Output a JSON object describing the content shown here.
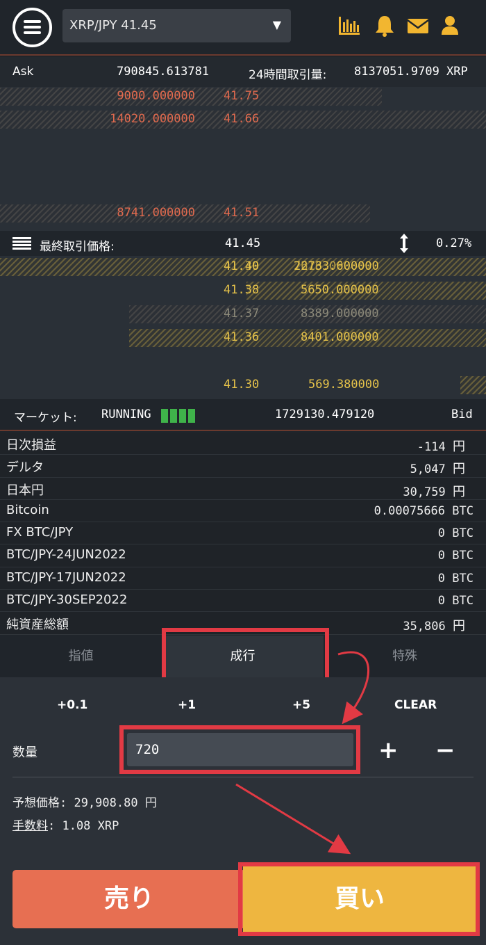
{
  "header": {
    "pair_selector": "XRP/JPY 41.45",
    "caret": "▼",
    "icons": [
      "chart-icon",
      "bell-icon",
      "mail-icon",
      "user-icon"
    ],
    "accent_color": "#f2b630"
  },
  "ask_bar": {
    "label": "Ask",
    "ask_total": "790845.613781",
    "volume_label": "24時間取引量:",
    "volume_value": "8137051.9709 XRP"
  },
  "asks": [
    {
      "amount": "9000.000000",
      "price": "41.75"
    },
    {
      "amount": "14020.000000",
      "price": "41.66"
    },
    {
      "amount": "8741.000000",
      "price": "41.51"
    }
  ],
  "last_trade": {
    "label": "最終取引価格:",
    "price": "41.45",
    "change": "0.27%"
  },
  "bids": [
    {
      "price": "41.40",
      "price_overlap": "41.39",
      "amount": "22733.600000",
      "amount_overlap": "7616.000000"
    },
    {
      "price": "41.38",
      "amount": "5650.000000"
    },
    {
      "price": "41.37",
      "amount": "8389.000000"
    },
    {
      "price": "41.36",
      "amount": "8401.000000"
    },
    {
      "price": "41.30",
      "amount": "569.380000"
    }
  ],
  "market_bar": {
    "label": "マーケット:",
    "status": "RUNNING",
    "bid_total": "1729130.479120",
    "bid_label": "Bid"
  },
  "balances": [
    {
      "label": "日次損益",
      "value": "-114",
      "unit": "円"
    },
    {
      "label": "デルタ",
      "value": "5,047",
      "unit": "円"
    },
    {
      "label": "日本円",
      "value": "30,759",
      "unit": "円"
    },
    {
      "label": "Bitcoin",
      "value": "0.00075666",
      "unit": "BTC"
    },
    {
      "label": "FX BTC/JPY",
      "value": "0",
      "unit": "BTC"
    },
    {
      "label": "BTC/JPY-24JUN2022",
      "value": "0",
      "unit": "BTC"
    },
    {
      "label": "BTC/JPY-17JUN2022",
      "value": "0",
      "unit": "BTC"
    },
    {
      "label": "BTC/JPY-30SEP2022",
      "value": "0",
      "unit": "BTC"
    },
    {
      "label": "純資産総額",
      "value": "35,806",
      "unit": "円"
    }
  ],
  "order_tabs": {
    "limit": "指値",
    "market": "成行",
    "special": "特殊"
  },
  "order": {
    "quick_buttons": [
      "+0.1",
      "+1",
      "+5",
      "CLEAR"
    ],
    "qty_label": "数量",
    "qty_value": "720",
    "plus": "+",
    "minus": "−",
    "est_label": "予想価格",
    "est_value": ": 29,908.80 円",
    "fee_label": "手数料",
    "fee_value": ": 1.08 XRP"
  },
  "actions": {
    "sell": "売り",
    "buy": "買い"
  },
  "colors": {
    "ask": "#e26a4e",
    "bid": "#e6c34a",
    "sell": "#e76f52",
    "buy": "#eeb640",
    "highlight": "#e23a44"
  }
}
